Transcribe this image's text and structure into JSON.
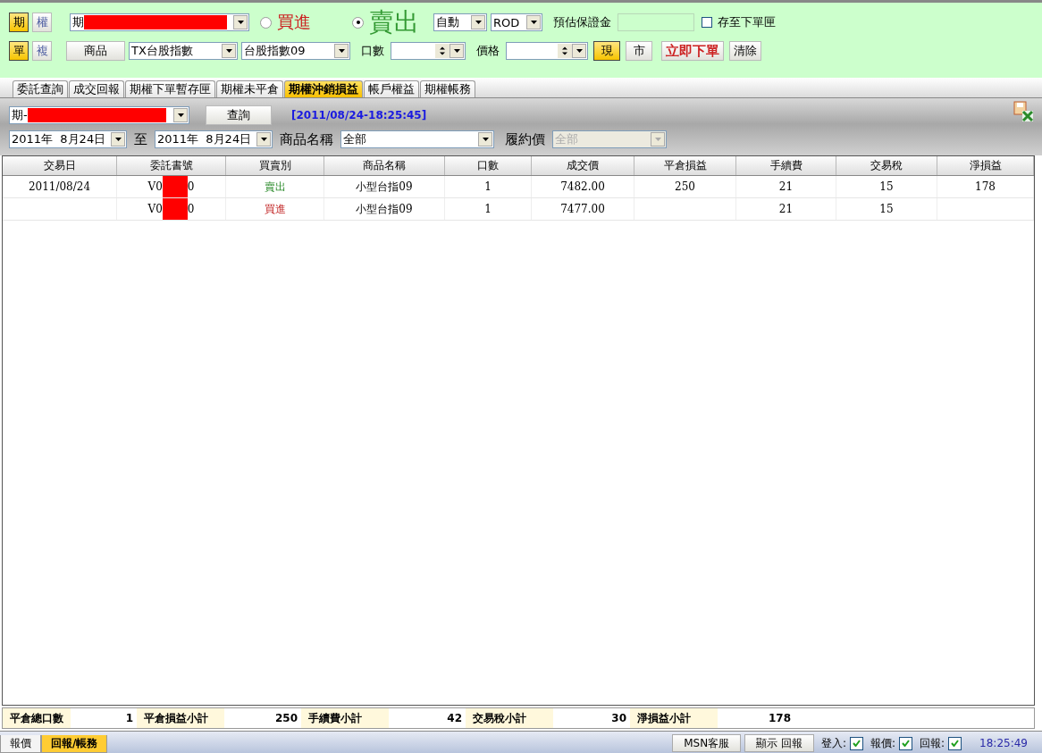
{
  "order_panel": {
    "market_buttons": [
      {
        "label": "期",
        "selected": true
      },
      {
        "label": "權",
        "selected": false
      }
    ],
    "account": {
      "value": "期"
    },
    "sides": [
      {
        "label": "買進",
        "selected": false,
        "kind": "buy"
      },
      {
        "label": "賣出",
        "selected": true,
        "kind": "sell"
      }
    ],
    "mode_select": {
      "value": "自動"
    },
    "term_select": {
      "value": "ROD"
    },
    "margin_label": "預估保證金",
    "save_checkbox": {
      "label": "存至下單匣",
      "checked": false
    },
    "leg_buttons": [
      {
        "label": "單",
        "selected": true
      },
      {
        "label": "複",
        "selected": false
      }
    ],
    "product_button": "商品",
    "product_select": {
      "value": "TX台股指數"
    },
    "contract_select": {
      "value": "台股指數09"
    },
    "qty_label": "口數",
    "price_label": "價格",
    "price_type_buttons": [
      {
        "label": "現",
        "selected": true
      },
      {
        "label": "市",
        "selected": false
      }
    ],
    "submit_button": "立即下單",
    "clear_button": "清除"
  },
  "tabs": [
    {
      "label": "委託查詢",
      "selected": false
    },
    {
      "label": "成交回報",
      "selected": false
    },
    {
      "label": "期權下單暫存匣",
      "selected": false
    },
    {
      "label": "期權未平倉",
      "selected": false
    },
    {
      "label": "期權沖銷損益",
      "selected": true
    },
    {
      "label": "帳戶權益",
      "selected": false
    },
    {
      "label": "期權帳務",
      "selected": false
    }
  ],
  "query": {
    "account": "期-",
    "query_button": "查詢",
    "timestamp": "[2011/08/24-18:25:45]",
    "date_from": "2011年  8月24日",
    "to_label": "至",
    "date_to": "2011年  8月24日",
    "product_label": "商品名稱",
    "product_value": "全部",
    "strike_label": "履約價",
    "strike_value": "全部"
  },
  "table": {
    "columns": [
      "交易日",
      "委託書號",
      "買賣別",
      "商品名稱",
      "口數",
      "成交價",
      "平倉損益",
      "手續費",
      "交易稅",
      "淨損益"
    ],
    "rows": [
      {
        "date": "2011/08/24",
        "order_no_start": "V0",
        "order_no_end": "0",
        "side": {
          "text": "賣出",
          "kind": "sell"
        },
        "product": "小型台指09",
        "qty": "1",
        "price": "7482.00",
        "pnl": "250",
        "fee": "21",
        "tax": "15",
        "net": "178"
      },
      {
        "date": "",
        "order_no_start": "V0",
        "order_no_end": "0",
        "side": {
          "text": "買進",
          "kind": "buy"
        },
        "product": "小型台指09",
        "qty": "1",
        "price": "7477.00",
        "pnl": "",
        "fee": "21",
        "tax": "15",
        "net": ""
      }
    ]
  },
  "summary": [
    {
      "label": "平倉總口數",
      "value": "1"
    },
    {
      "label": "平倉損益小計",
      "value": "250"
    },
    {
      "label": "手續費小計",
      "value": "42"
    },
    {
      "label": "交易稅小計",
      "value": "30"
    },
    {
      "label": "淨損益小計",
      "value": "178"
    }
  ],
  "bottom_tabs": [
    {
      "label": "報價",
      "selected": false
    },
    {
      "label": "回報/帳務",
      "selected": true
    }
  ],
  "status_bar": {
    "buttons": [
      "MSN客服",
      "顯示 回報"
    ],
    "checks": [
      {
        "label": "登入:",
        "checked": true
      },
      {
        "label": "報價:",
        "checked": true
      },
      {
        "label": "回報:",
        "checked": true
      }
    ],
    "time": "18:25:49"
  }
}
